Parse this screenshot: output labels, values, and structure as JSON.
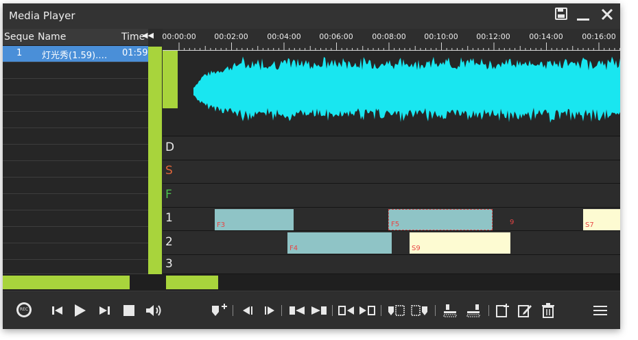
{
  "window": {
    "title": "Media Player"
  },
  "playlist": {
    "columns": {
      "seq": "Seque",
      "name": "Name",
      "time": "Time"
    },
    "rows": [
      {
        "seq": "1",
        "name": "灯光秀(1.59).…",
        "time": "01:59"
      }
    ]
  },
  "ruler": {
    "labels": [
      "00:00:00",
      "00:02:00",
      "00:04:00",
      "00:06:00",
      "00:08:00",
      "00:10:00",
      "00:12:00",
      "00:14:00",
      "00:16:00"
    ]
  },
  "tracks": [
    {
      "label": "D",
      "color": "#eaeaea"
    },
    {
      "label": "S",
      "color": "#e0663a"
    },
    {
      "label": "F",
      "color": "#4ec24e"
    },
    {
      "label": "1",
      "color": "#eaeaea"
    },
    {
      "label": "2",
      "color": "#eaeaea"
    },
    {
      "label": "3",
      "color": "#eaeaea"
    }
  ],
  "clips": {
    "f3": "F3",
    "f5": "F5",
    "n9": "9",
    "s7": "S7",
    "f4": "F4",
    "s9": "S9"
  },
  "controls": {
    "rec_label": "REC"
  },
  "colors": {
    "accent": "#a8d43c",
    "waveform": "#19e6f0",
    "selection": "#4a8fd8",
    "clip_label": "#e84545"
  }
}
